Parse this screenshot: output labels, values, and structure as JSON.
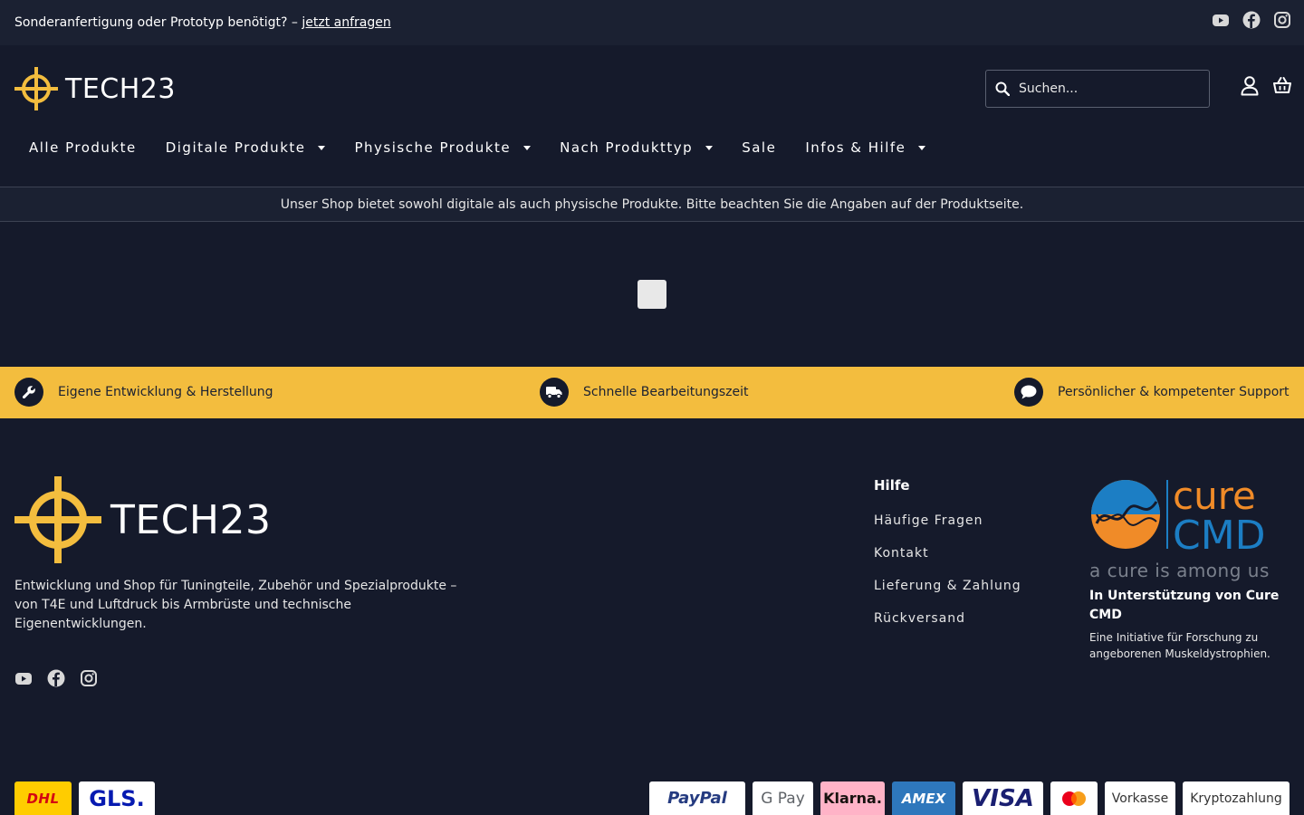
{
  "topbar": {
    "message": "Sonderanfertigung oder Prototyp benötigt? –",
    "link": "jetzt anfragen",
    "social": [
      "youtube-icon",
      "facebook-icon",
      "instagram-icon"
    ]
  },
  "header": {
    "brand": "TECH23",
    "search_placeholder": "Suchen...",
    "icons": [
      "user-icon",
      "basket-icon"
    ],
    "nav": [
      {
        "label": "Alle Produkte",
        "dropdown": false
      },
      {
        "label": "Digitale Produkte",
        "dropdown": true
      },
      {
        "label": "Physische Produkte",
        "dropdown": true
      },
      {
        "label": "Nach Produkttyp",
        "dropdown": true
      },
      {
        "label": "Sale",
        "dropdown": false
      },
      {
        "label": "Infos & Hilfe",
        "dropdown": true
      }
    ]
  },
  "notice": "Unser Shop bietet sowohl digitale als auch physische Produkte. Bitte beachten Sie die Angaben auf der Produktseite.",
  "features": [
    {
      "icon": "wrench-icon",
      "label": "Eigene Entwicklung & Herstellung"
    },
    {
      "icon": "truck-icon",
      "label": "Schnelle Bearbeitungszeit"
    },
    {
      "icon": "chat-icon",
      "label": "Persönlicher & kompetenter Support"
    }
  ],
  "footer": {
    "brand": "TECH23",
    "description": "Entwicklung und Shop für Tuningteile, Zubehör und Spezialprodukte – von T4E und Luftdruck bis Armbrüste und technische Eigenentwicklungen.",
    "help": {
      "title": "Hilfe",
      "links": [
        "Häufige Fragen",
        "Kontakt",
        "Lieferung & Zahlung",
        "Rückversand"
      ]
    },
    "cure": {
      "logo_top": "cure",
      "logo_bottom": "CMD",
      "tagline": "a cure is among us",
      "title": "In Unterstützung von Cure CMD",
      "text": "Eine Initiative für Forschung zu angeborenen Muskeldystrophien."
    },
    "shipping": [
      "DHL",
      "GLS."
    ],
    "payments": [
      "PayPal",
      "G Pay",
      "Klarna.",
      "AMEX",
      "VISA",
      "mastercard",
      "Vorkasse",
      "Kryptozahlung"
    ]
  },
  "colors": {
    "background": "#151a2b",
    "topbar": "#1b2132",
    "accent": "#f3bd3e"
  }
}
